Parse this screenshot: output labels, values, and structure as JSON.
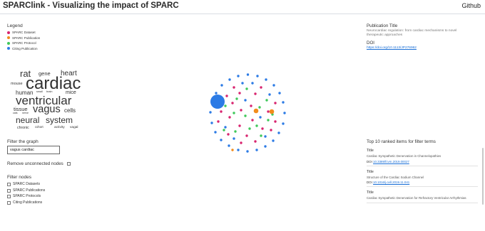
{
  "header": {
    "title": "SPARClink - Visualizing the impact of SPARC",
    "github_label": "Github"
  },
  "legend": {
    "title": "Legend",
    "items": [
      {
        "label": "SPARC Dataset",
        "color": "#d8246f"
      },
      {
        "label": "SPARC Publication",
        "color": "#f28c1c"
      },
      {
        "label": "SPARC Protocol",
        "color": "#3fc85a"
      },
      {
        "label": "Citing Publication",
        "color": "#2c7be5"
      }
    ]
  },
  "wordcloud": {
    "words": [
      "rat",
      "gene",
      "heart",
      "mouse",
      "cardiac",
      "human",
      "small",
      "brain",
      "mice",
      "ventricular",
      "tissue",
      "vagus",
      "cells",
      "cats",
      "nerve",
      "neural",
      "system",
      "chronic",
      "cohort",
      "activity",
      "vagal"
    ]
  },
  "filter": {
    "title": "Filter the graph",
    "value": "vagus cardiac",
    "remove_label": "Remove unconnected nodes",
    "nodes_title": "Filter nodes",
    "node_options": [
      "SPARC Datasets",
      "SPARC Publications",
      "SPARC Protocols",
      "Citing Publications"
    ]
  },
  "publication": {
    "title_label": "Publication Title",
    "title": "Neurocardiac regulation: from cardiac mechanisms to novel therapeutic approaches",
    "doi_label": "DOI",
    "doi": "https://doi.org/10.1113/JP276962"
  },
  "top_items": {
    "title": "Top 10 ranked items for filter terms",
    "items": [
      {
        "label": "Title",
        "text": "Cardiac Sympathetic Denervation in Channelopathies",
        "doi_label": "DOI",
        "doi": "10.3389/fcvm.2019.00027"
      },
      {
        "label": "Title",
        "text": "Structure of the Cardiac Sodium Channel",
        "doi_label": "DOI",
        "doi": "10.1016/j.cell.2019.11.041"
      },
      {
        "label": "Title",
        "text": "Cardiac Sympathetic Denervation for Refractory Ventricular Arrhythmias",
        "doi_label": "",
        "doi": ""
      }
    ]
  }
}
